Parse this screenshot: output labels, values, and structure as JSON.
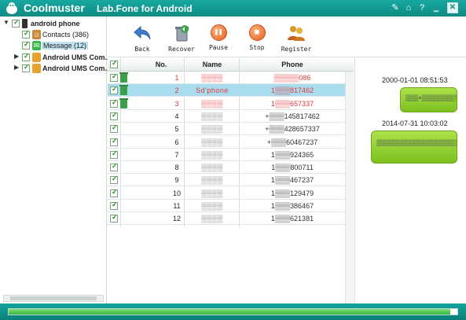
{
  "app": {
    "title_brand": "Coolmuster",
    "title_sub": "Lab.Fone for Android",
    "titlebar_buttons": [
      {
        "name": "settings-icon",
        "glyph": "✎"
      },
      {
        "name": "home-icon",
        "glyph": "⌂"
      },
      {
        "name": "help-icon",
        "glyph": "?"
      },
      {
        "name": "minimize-icon",
        "glyph": "‗"
      },
      {
        "name": "close-icon",
        "glyph": "✕"
      }
    ]
  },
  "tree": {
    "root": "android phone",
    "contacts": "Contacts (386)",
    "message": "Message (12)",
    "ums1": "Android   UMS Com...",
    "ums2": "Android   UMS Com..."
  },
  "toolbar": {
    "back": "Back",
    "recover": "Recover",
    "pause": "Pause",
    "stop": "Stop",
    "register": "Register"
  },
  "table": {
    "headers": {
      "no": "No.",
      "name": "Name",
      "phone": "Phone"
    },
    "rows": [
      {
        "no": "1",
        "name": "▒▒▒▒",
        "phone": "▒▒▒▒▒086",
        "deleted": true
      },
      {
        "no": "2",
        "name": "Sd'phone",
        "phone": "1▒▒▒817462",
        "deleted": true
      },
      {
        "no": "3",
        "name": "▒▒▒▒",
        "phone": "1▒▒▒657337",
        "deleted": true
      },
      {
        "no": "4",
        "name": "▒▒▒▒",
        "phone": "+▒▒▒145817462",
        "deleted": false
      },
      {
        "no": "5",
        "name": "▒▒▒▒",
        "phone": "+▒▒▒428657337",
        "deleted": false
      },
      {
        "no": "6",
        "name": "▒▒▒▒",
        "phone": "+▒▒▒60467237",
        "deleted": false
      },
      {
        "no": "7",
        "name": "▒▒▒▒",
        "phone": "1▒▒▒924365",
        "deleted": false
      },
      {
        "no": "8",
        "name": "▒▒▒▒",
        "phone": "1▒▒▒800711",
        "deleted": false
      },
      {
        "no": "9",
        "name": "▒▒▒▒",
        "phone": "1▒▒▒467237",
        "deleted": false
      },
      {
        "no": "10",
        "name": "▒▒▒▒",
        "phone": "1▒▒▒129479",
        "deleted": false
      },
      {
        "no": "11",
        "name": "▒▒▒▒",
        "phone": "1▒▒▒386467",
        "deleted": false
      },
      {
        "no": "12",
        "name": "▒▒▒▒",
        "phone": "1▒▒▒621381",
        "deleted": false
      }
    ]
  },
  "chat": {
    "messages": [
      {
        "timestamp": "2000-01-01 08:51:53",
        "text": "▒▒▒+▒▒▒▒▒▒▒▒▒"
      },
      {
        "timestamp": "2014-07-31 10:03:02",
        "text": "▒▒▒▒▒▒▒▒▒▒▒▒▒▒▒▒▒▒▒▒▒▒▒▒"
      }
    ]
  },
  "status": {
    "progress": 0.985
  },
  "colors": {
    "brand_teal": "#0e8c84",
    "deleted_red": "#e23a3a",
    "selected_row": "#aadcef",
    "bubble_green": "#8ccd2e"
  }
}
